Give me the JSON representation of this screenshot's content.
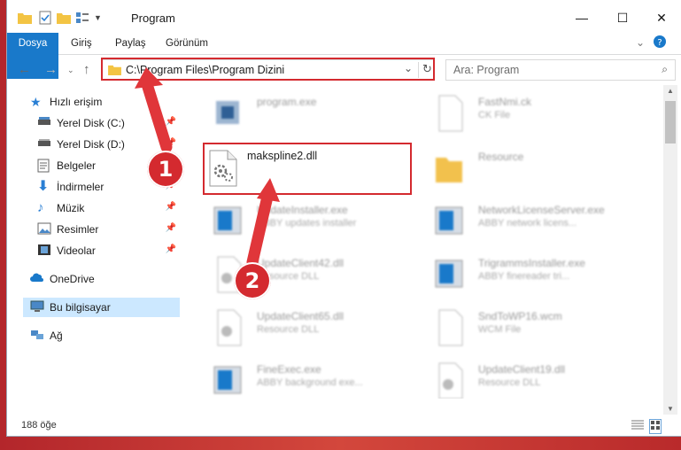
{
  "window": {
    "title": "Program",
    "controls": {
      "minimize": "—",
      "maximize": "☐",
      "close": "✕"
    }
  },
  "ribbon": {
    "tabs": [
      "Dosya",
      "Giriş",
      "Paylaş",
      "Görünüm"
    ]
  },
  "nav": {
    "address": "C:\\Program Files\\Program Dizini",
    "search_placeholder": "Ara: Program"
  },
  "sidebar": {
    "quick_access": "Hızlı erişim",
    "items": [
      {
        "label": "Yerel Disk (C:)",
        "icon": "drive-icon"
      },
      {
        "label": "Yerel Disk (D:)",
        "icon": "drive-icon"
      },
      {
        "label": "Belgeler",
        "icon": "documents-icon"
      },
      {
        "label": "İndirmeler",
        "icon": "download-icon"
      },
      {
        "label": "Müzik",
        "icon": "music-icon"
      },
      {
        "label": "Resimler",
        "icon": "pictures-icon"
      },
      {
        "label": "Videolar",
        "icon": "videos-icon"
      }
    ],
    "onedrive": "OneDrive",
    "this_pc": "Bu bilgisayar",
    "network": "Ağ"
  },
  "files": [
    {
      "name": "program.exe",
      "sub": ""
    },
    {
      "name": "FastNmi.ck",
      "sub": "CK File"
    },
    {
      "name": "makspline2.dll",
      "sub": ""
    },
    {
      "name": "Resource",
      "sub": ""
    },
    {
      "name": "UpdateInstaller.exe",
      "sub": "ABBY updates installer"
    },
    {
      "name": "NetworkLicenseServer.exe",
      "sub": "ABBY network licens..."
    },
    {
      "name": "UpdateClient42.dll",
      "sub": "Resource DLL"
    },
    {
      "name": "TrigrammsInstaller.exe",
      "sub": "ABBY finereader tri..."
    },
    {
      "name": "UpdateClient65.dll",
      "sub": "Resource DLL"
    },
    {
      "name": "SndToWP16.wcm",
      "sub": "WCM File"
    },
    {
      "name": "FineExec.exe",
      "sub": "ABBY background exe..."
    },
    {
      "name": "UpdateClient19.dll",
      "sub": "Resource DLL"
    }
  ],
  "status": {
    "count": "188 öğe"
  },
  "callouts": {
    "one": "1",
    "two": "2"
  },
  "colors": {
    "accent": "#1979ca",
    "highlight": "#d42a2f"
  }
}
